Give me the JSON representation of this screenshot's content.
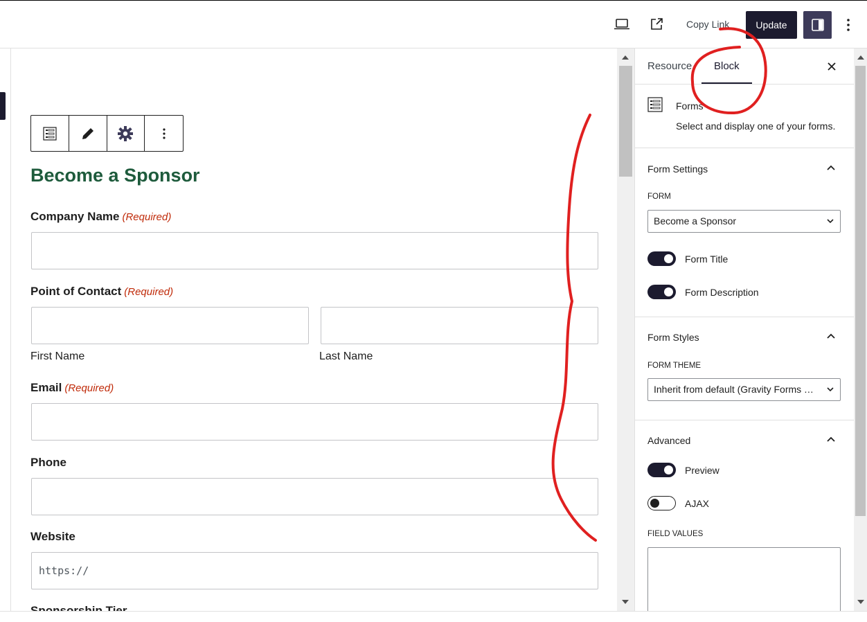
{
  "header": {
    "copy_link_label": "Copy Link",
    "update_label": "Update",
    "icons": [
      "desktop-preview-icon",
      "external-link-icon",
      "sidebar-toggle-icon",
      "more-options-icon"
    ]
  },
  "block_toolbar": {
    "icons": [
      "form-block-icon",
      "edit-pencil-icon",
      "settings-gear-icon",
      "more-vertical-icon"
    ]
  },
  "form": {
    "title": "Become a Sponsor",
    "required_text": "(Required)",
    "fields": {
      "company": {
        "label": "Company Name",
        "value": ""
      },
      "contact": {
        "label": "Point of Contact",
        "first_sub": "First Name",
        "last_sub": "Last Name"
      },
      "email": {
        "label": "Email",
        "value": ""
      },
      "phone": {
        "label": "Phone",
        "value": ""
      },
      "website": {
        "label": "Website",
        "placeholder": "https://"
      },
      "tier": {
        "label": "Sponsorship Tier"
      }
    }
  },
  "panel": {
    "tabs": [
      "Resource",
      "Block"
    ],
    "active_tab": "Block",
    "block_name": "Forms",
    "block_desc": "Select and display one of your forms.",
    "form_settings": {
      "title": "Form Settings",
      "form_label": "FORM",
      "form_value": "Become a Sponsor",
      "toggles": [
        {
          "label": "Form Title",
          "on": true
        },
        {
          "label": "Form Description",
          "on": true
        }
      ]
    },
    "form_styles": {
      "title": "Form Styles",
      "theme_label": "FORM THEME",
      "theme_value": "Inherit from default (Gravity Forms Theme)"
    },
    "advanced": {
      "title": "Advanced",
      "toggles": [
        {
          "label": "Preview",
          "on": true
        },
        {
          "label": "AJAX",
          "on": false
        }
      ],
      "field_values_label": "FIELD VALUES"
    }
  },
  "colors": {
    "accent": "#1c1b2f",
    "title_green": "#1e5b3c",
    "required_red": "#c02b0a",
    "annotation_red": "#e02020"
  }
}
